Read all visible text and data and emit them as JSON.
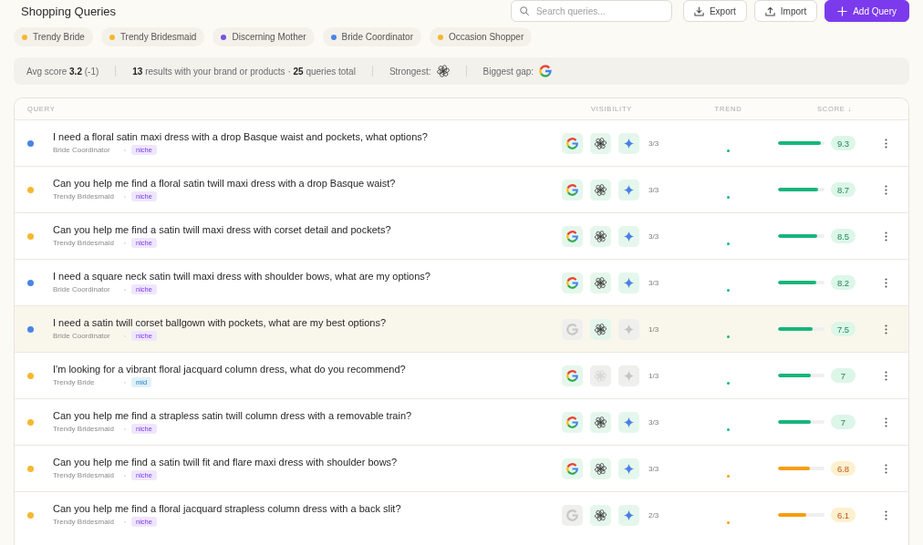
{
  "header": {
    "title": "Shopping Queries",
    "search": {
      "placeholder": "Search queries..."
    },
    "buttons": [
      {
        "label": "Export",
        "kind": "export"
      },
      {
        "label": "Import",
        "kind": "import"
      },
      {
        "label": "Add Query",
        "kind": "primary"
      }
    ]
  },
  "personas": [
    {
      "name": "Trendy Bride",
      "color": "#f5b82e"
    },
    {
      "name": "Trendy Bridesmaid",
      "color": "#f5b82e"
    },
    {
      "name": "Discerning Mother",
      "color": "#7b4fe0"
    },
    {
      "name": "Bride Coordinator",
      "color": "#4a84e6"
    },
    {
      "name": "Occasion Shopper",
      "color": "#f5b82e"
    }
  ],
  "stats": {
    "avg_score": "Avg score **3.2** (-1)",
    "summary": "**13** results with your brand or products · **25** queries total",
    "strongest": {
      "label": "Strongest:",
      "kind": "chatgpt"
    },
    "biggest_gap": {
      "label": "Biggest gap:",
      "kind": "google"
    }
  },
  "table": {
    "columns": [
      "QUERY",
      "VISIBILITY",
      "TREND",
      "SCORE ↓"
    ],
    "rows": [
      {
        "color": "#4a84e6",
        "query": "I need a floral satin maxi dress with a drop Basque waist and pockets, what options?",
        "persona": "Bride Coordinator",
        "tag": {
          "text": "niche",
          "kind": "niche"
        },
        "engines": [
          {
            "kind": "google",
            "visible": true
          },
          {
            "kind": "chatgpt",
            "visible": true
          },
          {
            "kind": "gemini",
            "visible": true
          }
        ],
        "visibility": "3/3",
        "score": {
          "text": "9.3",
          "level": 0.93,
          "kind": "good"
        },
        "highlighted": false
      },
      {
        "color": "#f5b82e",
        "query": "Can you help me find a floral satin twill maxi dress with a drop Basque waist?",
        "persona": "Trendy Bridesmaid",
        "tag": {
          "text": "niche",
          "kind": "niche"
        },
        "engines": [
          {
            "kind": "google",
            "visible": true
          },
          {
            "kind": "chatgpt",
            "visible": true
          },
          {
            "kind": "gemini",
            "visible": true
          }
        ],
        "visibility": "3/3",
        "score": {
          "text": "8.7",
          "level": 0.87,
          "kind": "good"
        },
        "highlighted": false
      },
      {
        "color": "#f5b82e",
        "query": "Can you help me find a satin twill maxi dress with corset detail and pockets?",
        "persona": "Trendy Bridesmaid",
        "tag": {
          "text": "niche",
          "kind": "niche"
        },
        "engines": [
          {
            "kind": "google",
            "visible": true
          },
          {
            "kind": "chatgpt",
            "visible": true
          },
          {
            "kind": "gemini",
            "visible": true
          }
        ],
        "visibility": "3/3",
        "score": {
          "text": "8.5",
          "level": 0.85,
          "kind": "good"
        },
        "highlighted": false
      },
      {
        "color": "#4a84e6",
        "query": "I need a square neck satin twill maxi dress with shoulder bows, what are my options?",
        "persona": "Bride Coordinator",
        "tag": {
          "text": "niche",
          "kind": "niche"
        },
        "engines": [
          {
            "kind": "google",
            "visible": true
          },
          {
            "kind": "chatgpt",
            "visible": true
          },
          {
            "kind": "gemini",
            "visible": true
          }
        ],
        "visibility": "3/3",
        "score": {
          "text": "8.2",
          "level": 0.82,
          "kind": "good"
        },
        "highlighted": false
      },
      {
        "color": "#4a84e6",
        "query": "I need a satin twill corset ballgown with pockets, what are my best options?",
        "persona": "Bride Coordinator",
        "tag": {
          "text": "niche",
          "kind": "niche"
        },
        "engines": [
          {
            "kind": "google",
            "visible": false
          },
          {
            "kind": "chatgpt",
            "visible": true
          },
          {
            "kind": "gemini",
            "visible": false
          }
        ],
        "visibility": "1/3",
        "score": {
          "text": "7.5",
          "level": 0.75,
          "kind": "good"
        },
        "highlighted": true
      },
      {
        "color": "#f5b82e",
        "query": "I'm looking for a vibrant floral jacquard column dress, what do you recommend?",
        "persona": "Trendy Bride",
        "tag": {
          "text": "mid",
          "kind": "mid"
        },
        "engines": [
          {
            "kind": "google",
            "visible": true
          },
          {
            "kind": "chatgpt",
            "visible": false
          },
          {
            "kind": "gemini",
            "visible": false
          }
        ],
        "visibility": "1/3",
        "score": {
          "text": "7",
          "level": 0.7,
          "kind": "good"
        },
        "highlighted": false
      },
      {
        "color": "#f5b82e",
        "query": "Can you help me find a strapless satin twill column dress with a removable train?",
        "persona": "Trendy Bridesmaid",
        "tag": {
          "text": "niche",
          "kind": "niche"
        },
        "engines": [
          {
            "kind": "google",
            "visible": true
          },
          {
            "kind": "chatgpt",
            "visible": true
          },
          {
            "kind": "gemini",
            "visible": true
          }
        ],
        "visibility": "3/3",
        "score": {
          "text": "7",
          "level": 0.7,
          "kind": "good"
        },
        "highlighted": false
      },
      {
        "color": "#f5b82e",
        "query": "Can you help me find a satin twill fit and flare maxi dress with shoulder bows?",
        "persona": "Trendy Bridesmaid",
        "tag": {
          "text": "niche",
          "kind": "niche"
        },
        "engines": [
          {
            "kind": "google",
            "visible": true
          },
          {
            "kind": "chatgpt",
            "visible": true
          },
          {
            "kind": "gemini",
            "visible": true
          }
        ],
        "visibility": "3/3",
        "score": {
          "text": "6.8",
          "level": 0.68,
          "kind": "fair"
        },
        "highlighted": false
      },
      {
        "color": "#f5b82e",
        "query": "Can you help me find a floral jacquard strapless column dress with a back slit?",
        "persona": "Trendy Bridesmaid",
        "tag": {
          "text": "niche",
          "kind": "niche"
        },
        "engines": [
          {
            "kind": "google",
            "visible": false
          },
          {
            "kind": "chatgpt",
            "visible": true
          },
          {
            "kind": "gemini",
            "visible": true
          }
        ],
        "visibility": "2/3",
        "score": {
          "text": "6.1",
          "level": 0.61,
          "kind": "fair"
        },
        "highlighted": false
      }
    ]
  }
}
